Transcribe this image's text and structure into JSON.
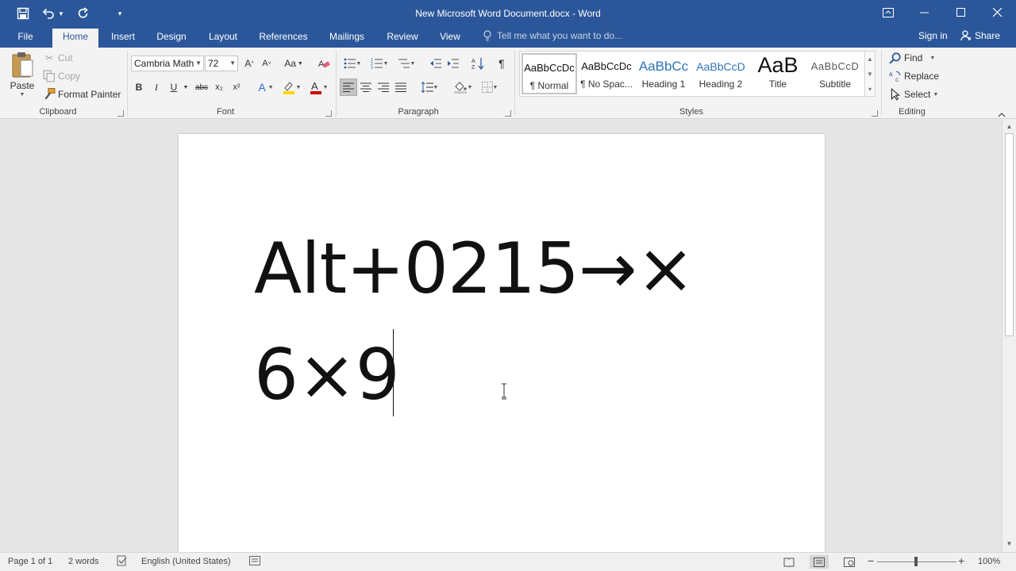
{
  "window": {
    "title": "New Microsoft Word Document.docx - Word"
  },
  "tabs": {
    "file": "File",
    "home": "Home",
    "insert": "Insert",
    "design": "Design",
    "layout": "Layout",
    "references": "References",
    "mailings": "Mailings",
    "review": "Review",
    "view": "View",
    "tell_me": "Tell me what you want to do...",
    "sign_in": "Sign in",
    "share": "Share"
  },
  "clipboard": {
    "paste": "Paste",
    "cut": "Cut",
    "copy": "Copy",
    "format_painter": "Format Painter",
    "group_label": "Clipboard"
  },
  "font": {
    "name": "Cambria Math",
    "size": "72",
    "group_label": "Font",
    "grow": "A",
    "shrink": "A",
    "case": "Aa",
    "bold": "B",
    "italic": "I",
    "underline": "U",
    "strike": "abc",
    "subscript": "x₂",
    "superscript": "x²",
    "text_effects": "A",
    "highlight_color": "#ffd700",
    "font_color": "#d00000"
  },
  "paragraph": {
    "group_label": "Paragraph",
    "pilcrow": "¶"
  },
  "styles": {
    "group_label": "Styles",
    "items": [
      {
        "sample": "AaBbCcDc",
        "name": "¶ Normal"
      },
      {
        "sample": "AaBbCcDc",
        "name": "¶ No Spac..."
      },
      {
        "sample": "AaBbCc",
        "name": "Heading 1"
      },
      {
        "sample": "AaBbCcD",
        "name": "Heading 2"
      },
      {
        "sample": "AaB",
        "name": "Title"
      },
      {
        "sample": "AaBbCcD",
        "name": "Subtitle"
      }
    ]
  },
  "editing": {
    "find": "Find",
    "replace": "Replace",
    "select": "Select",
    "group_label": "Editing"
  },
  "document": {
    "line1": "Alt+0215→×",
    "line2": "6×9"
  },
  "status": {
    "page": "Page 1 of 1",
    "words": "2 words",
    "language": "English (United States)",
    "zoom": "100%",
    "zoom_minus": "−",
    "zoom_plus": "+"
  },
  "colors": {
    "accent": "#2b579a",
    "heading": "#2e74b5"
  }
}
